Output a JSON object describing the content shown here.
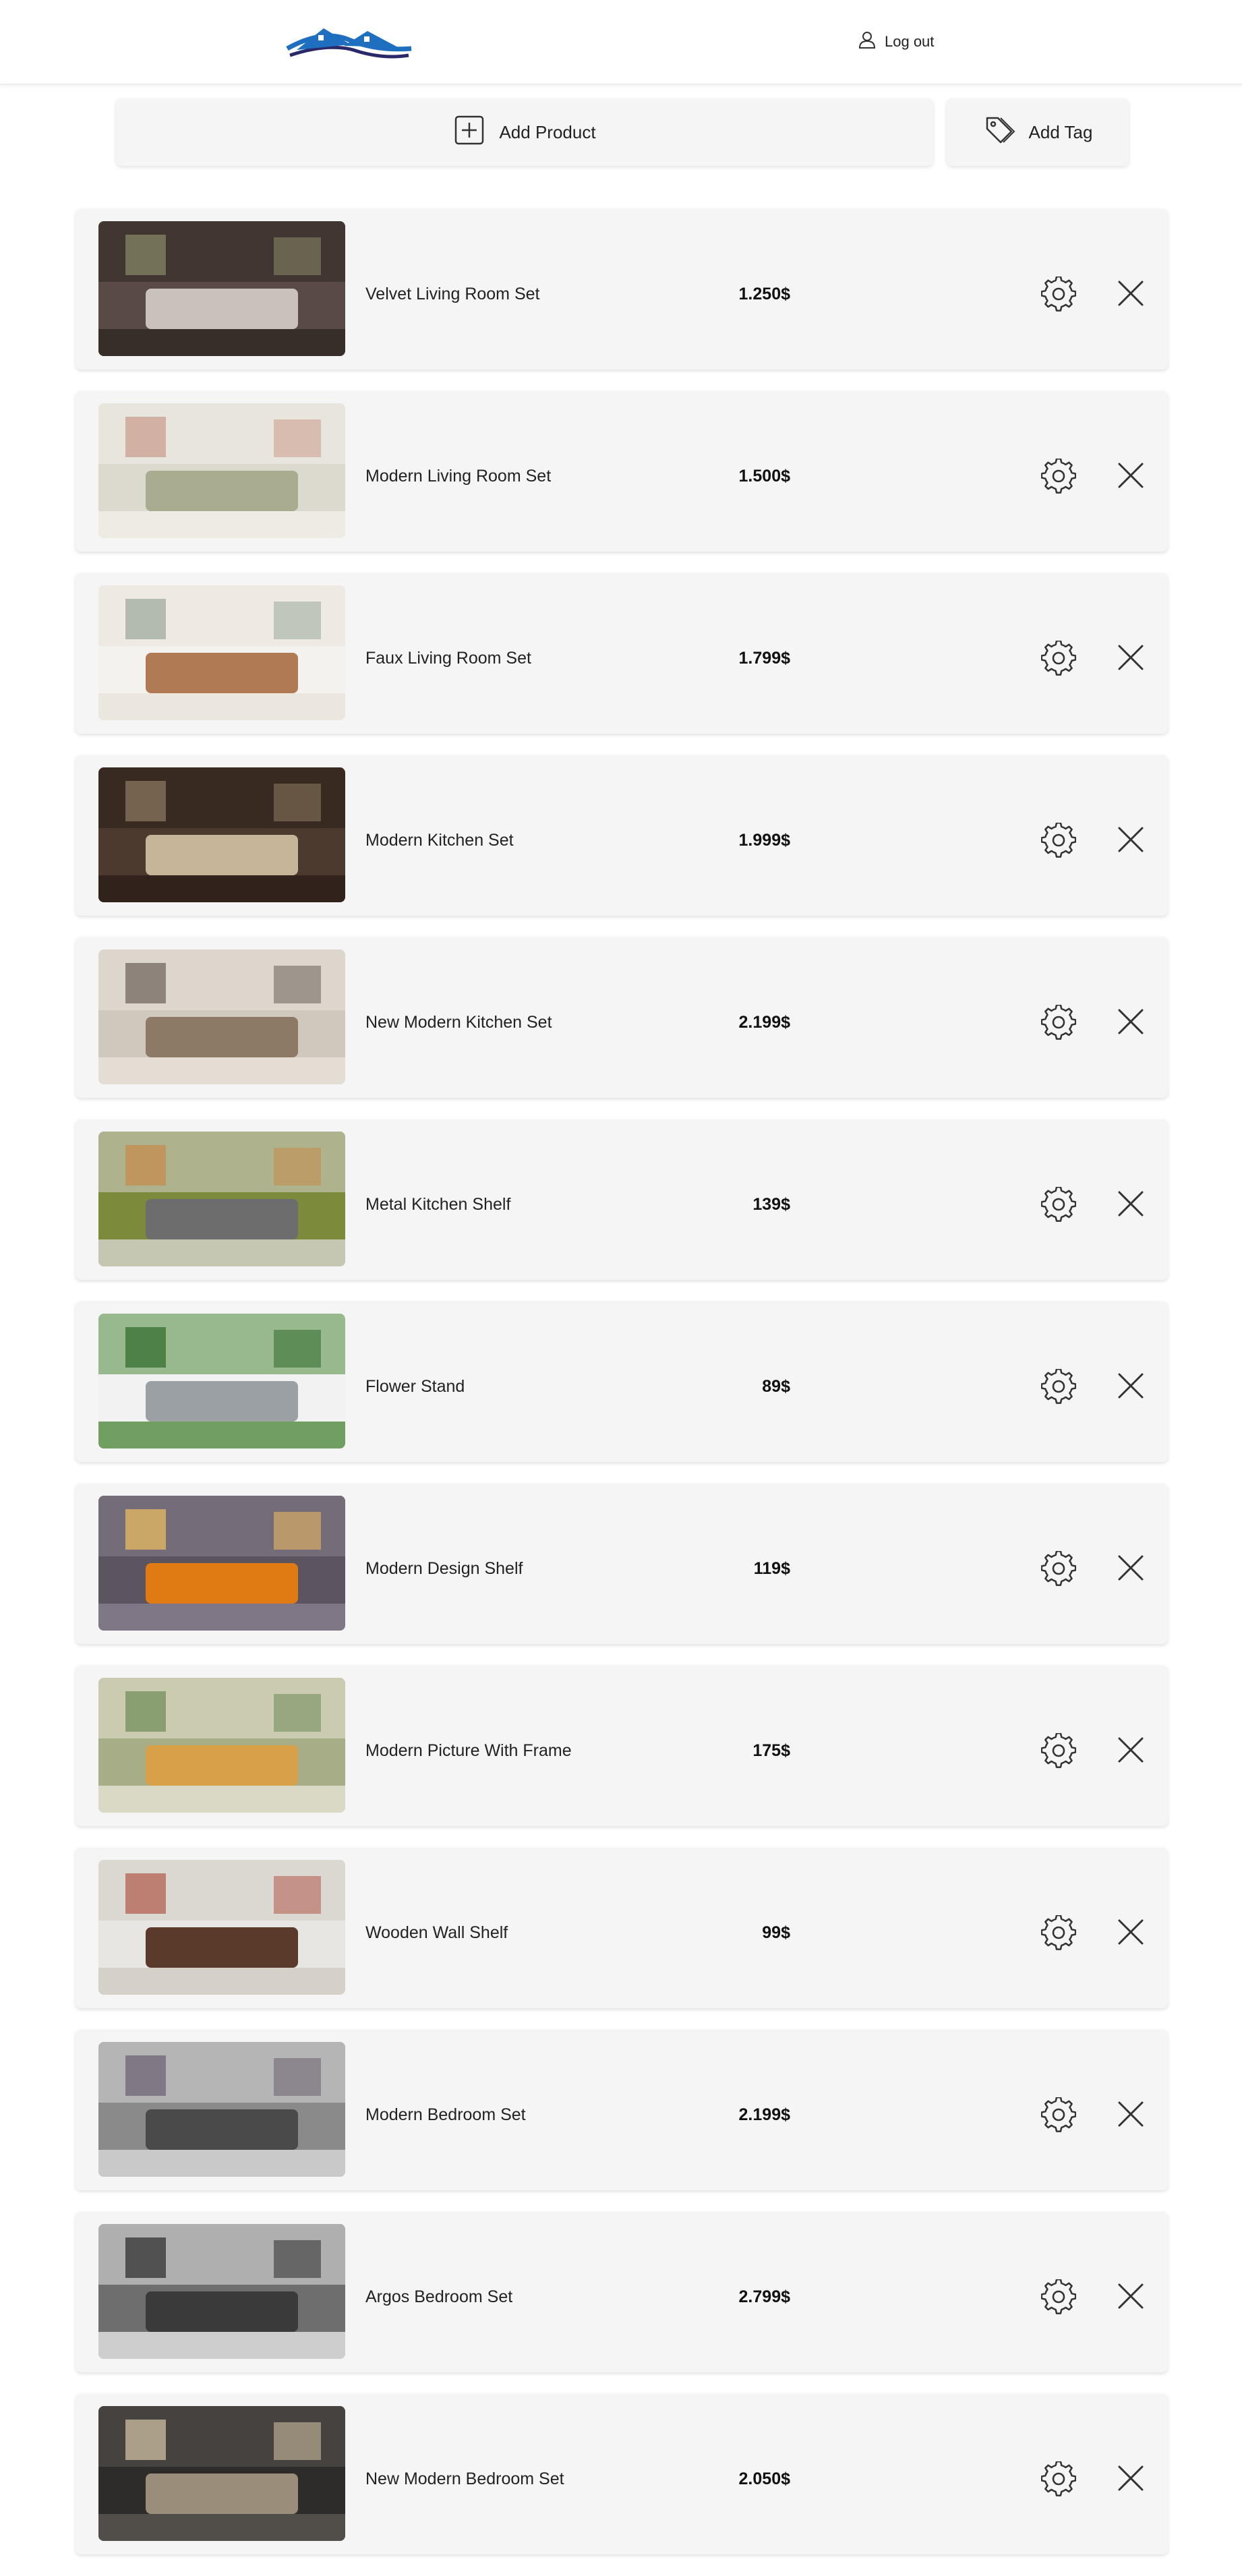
{
  "header": {
    "logo_icon": "house-roof-logo",
    "logout_label": "Log out",
    "logout_icon": "user-icon"
  },
  "actions": {
    "add_product_label": "Add Product",
    "add_product_icon": "plus-square-icon",
    "add_tag_label": "Add Tag",
    "add_tag_icon": "tag-icon"
  },
  "colors": {
    "brand_blue": "#1e6fc0",
    "card_bg": "#f5f5f5"
  },
  "products": [
    {
      "name": "Velvet Living Room Set",
      "price": "1.250$",
      "image": "living-room-photo"
    },
    {
      "name": "Modern Living Room Set",
      "price": "1.500$",
      "image": "living-room-photo"
    },
    {
      "name": "Faux Living Room Set",
      "price": "1.799$",
      "image": "living-room-photo"
    },
    {
      "name": "Modern Kitchen Set",
      "price": "1.999$",
      "image": "kitchen-photo"
    },
    {
      "name": "New Modern Kitchen Set",
      "price": "2.199$",
      "image": "kitchen-photo"
    },
    {
      "name": "Metal Kitchen Shelf",
      "price": "139$",
      "image": "shelf-photo"
    },
    {
      "name": "Flower Stand",
      "price": "89$",
      "image": "plant-stand-photo"
    },
    {
      "name": "Modern Design Shelf",
      "price": "119$",
      "image": "shelf-photo"
    },
    {
      "name": "Modern Picture With Frame",
      "price": "175$",
      "image": "picture-frames-photo"
    },
    {
      "name": "Wooden Wall Shelf",
      "price": "99$",
      "image": "shelf-photo"
    },
    {
      "name": "Modern Bedroom Set",
      "price": "2.199$",
      "image": "bedroom-photo"
    },
    {
      "name": "Argos Bedroom Set",
      "price": "2.799$",
      "image": "bedroom-photo"
    },
    {
      "name": "New Modern Bedroom Set",
      "price": "2.050$",
      "image": "bedroom-photo"
    }
  ]
}
